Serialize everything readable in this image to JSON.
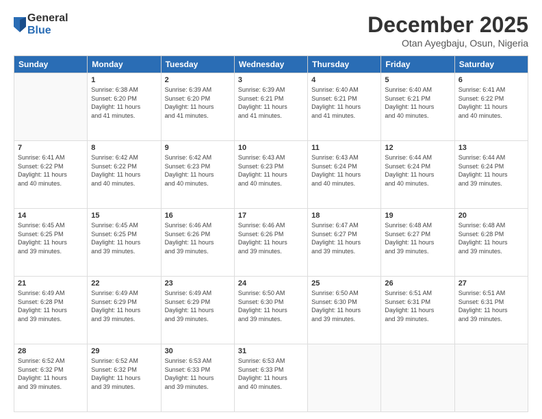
{
  "logo": {
    "general": "General",
    "blue": "Blue"
  },
  "title": "December 2025",
  "location": "Otan Ayegbaju, Osun, Nigeria",
  "weekdays": [
    "Sunday",
    "Monday",
    "Tuesday",
    "Wednesday",
    "Thursday",
    "Friday",
    "Saturday"
  ],
  "weeks": [
    [
      {
        "day": "",
        "info": ""
      },
      {
        "day": "1",
        "info": "Sunrise: 6:38 AM\nSunset: 6:20 PM\nDaylight: 11 hours\nand 41 minutes."
      },
      {
        "day": "2",
        "info": "Sunrise: 6:39 AM\nSunset: 6:20 PM\nDaylight: 11 hours\nand 41 minutes."
      },
      {
        "day": "3",
        "info": "Sunrise: 6:39 AM\nSunset: 6:21 PM\nDaylight: 11 hours\nand 41 minutes."
      },
      {
        "day": "4",
        "info": "Sunrise: 6:40 AM\nSunset: 6:21 PM\nDaylight: 11 hours\nand 41 minutes."
      },
      {
        "day": "5",
        "info": "Sunrise: 6:40 AM\nSunset: 6:21 PM\nDaylight: 11 hours\nand 40 minutes."
      },
      {
        "day": "6",
        "info": "Sunrise: 6:41 AM\nSunset: 6:22 PM\nDaylight: 11 hours\nand 40 minutes."
      }
    ],
    [
      {
        "day": "7",
        "info": "Sunrise: 6:41 AM\nSunset: 6:22 PM\nDaylight: 11 hours\nand 40 minutes."
      },
      {
        "day": "8",
        "info": "Sunrise: 6:42 AM\nSunset: 6:22 PM\nDaylight: 11 hours\nand 40 minutes."
      },
      {
        "day": "9",
        "info": "Sunrise: 6:42 AM\nSunset: 6:23 PM\nDaylight: 11 hours\nand 40 minutes."
      },
      {
        "day": "10",
        "info": "Sunrise: 6:43 AM\nSunset: 6:23 PM\nDaylight: 11 hours\nand 40 minutes."
      },
      {
        "day": "11",
        "info": "Sunrise: 6:43 AM\nSunset: 6:24 PM\nDaylight: 11 hours\nand 40 minutes."
      },
      {
        "day": "12",
        "info": "Sunrise: 6:44 AM\nSunset: 6:24 PM\nDaylight: 11 hours\nand 40 minutes."
      },
      {
        "day": "13",
        "info": "Sunrise: 6:44 AM\nSunset: 6:24 PM\nDaylight: 11 hours\nand 39 minutes."
      }
    ],
    [
      {
        "day": "14",
        "info": "Sunrise: 6:45 AM\nSunset: 6:25 PM\nDaylight: 11 hours\nand 39 minutes."
      },
      {
        "day": "15",
        "info": "Sunrise: 6:45 AM\nSunset: 6:25 PM\nDaylight: 11 hours\nand 39 minutes."
      },
      {
        "day": "16",
        "info": "Sunrise: 6:46 AM\nSunset: 6:26 PM\nDaylight: 11 hours\nand 39 minutes."
      },
      {
        "day": "17",
        "info": "Sunrise: 6:46 AM\nSunset: 6:26 PM\nDaylight: 11 hours\nand 39 minutes."
      },
      {
        "day": "18",
        "info": "Sunrise: 6:47 AM\nSunset: 6:27 PM\nDaylight: 11 hours\nand 39 minutes."
      },
      {
        "day": "19",
        "info": "Sunrise: 6:48 AM\nSunset: 6:27 PM\nDaylight: 11 hours\nand 39 minutes."
      },
      {
        "day": "20",
        "info": "Sunrise: 6:48 AM\nSunset: 6:28 PM\nDaylight: 11 hours\nand 39 minutes."
      }
    ],
    [
      {
        "day": "21",
        "info": "Sunrise: 6:49 AM\nSunset: 6:28 PM\nDaylight: 11 hours\nand 39 minutes."
      },
      {
        "day": "22",
        "info": "Sunrise: 6:49 AM\nSunset: 6:29 PM\nDaylight: 11 hours\nand 39 minutes."
      },
      {
        "day": "23",
        "info": "Sunrise: 6:49 AM\nSunset: 6:29 PM\nDaylight: 11 hours\nand 39 minutes."
      },
      {
        "day": "24",
        "info": "Sunrise: 6:50 AM\nSunset: 6:30 PM\nDaylight: 11 hours\nand 39 minutes."
      },
      {
        "day": "25",
        "info": "Sunrise: 6:50 AM\nSunset: 6:30 PM\nDaylight: 11 hours\nand 39 minutes."
      },
      {
        "day": "26",
        "info": "Sunrise: 6:51 AM\nSunset: 6:31 PM\nDaylight: 11 hours\nand 39 minutes."
      },
      {
        "day": "27",
        "info": "Sunrise: 6:51 AM\nSunset: 6:31 PM\nDaylight: 11 hours\nand 39 minutes."
      }
    ],
    [
      {
        "day": "28",
        "info": "Sunrise: 6:52 AM\nSunset: 6:32 PM\nDaylight: 11 hours\nand 39 minutes."
      },
      {
        "day": "29",
        "info": "Sunrise: 6:52 AM\nSunset: 6:32 PM\nDaylight: 11 hours\nand 39 minutes."
      },
      {
        "day": "30",
        "info": "Sunrise: 6:53 AM\nSunset: 6:33 PM\nDaylight: 11 hours\nand 39 minutes."
      },
      {
        "day": "31",
        "info": "Sunrise: 6:53 AM\nSunset: 6:33 PM\nDaylight: 11 hours\nand 40 minutes."
      },
      {
        "day": "",
        "info": ""
      },
      {
        "day": "",
        "info": ""
      },
      {
        "day": "",
        "info": ""
      }
    ]
  ]
}
